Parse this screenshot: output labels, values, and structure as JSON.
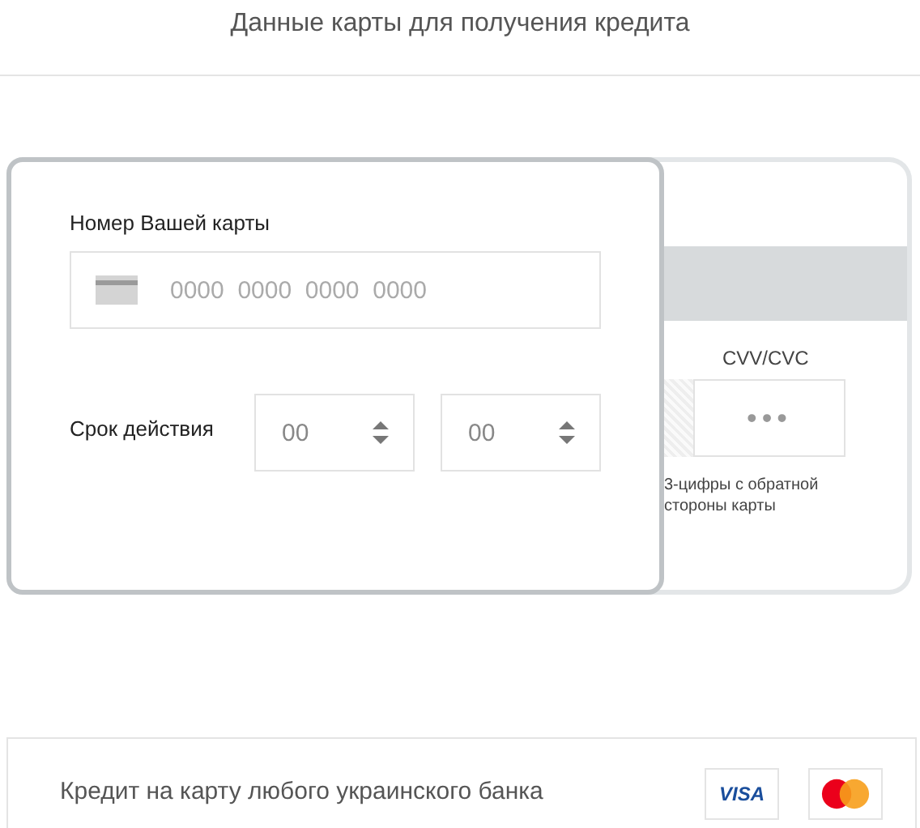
{
  "header": {
    "title": "Данные карты для получения кредита"
  },
  "card_front": {
    "number_label": "Номер Вашей карты",
    "number_field": {
      "placeholder": "0000  0000  0000  0000"
    },
    "expiry_label": "Срок действия",
    "expiry_fields": [
      {
        "placeholder": "00"
      },
      {
        "placeholder": "00"
      }
    ]
  },
  "card_back": {
    "cvv_label": "CVV/CVC",
    "cvv_field": {
      "placeholder": "•••"
    },
    "hint": "3-цифры с обратной стороны карты"
  },
  "footer": {
    "text": "Кредит на карту любого украинского банка",
    "logos": [
      {
        "kind": "visa",
        "label": "VISA"
      },
      {
        "kind": "mastercard"
      }
    ]
  }
}
